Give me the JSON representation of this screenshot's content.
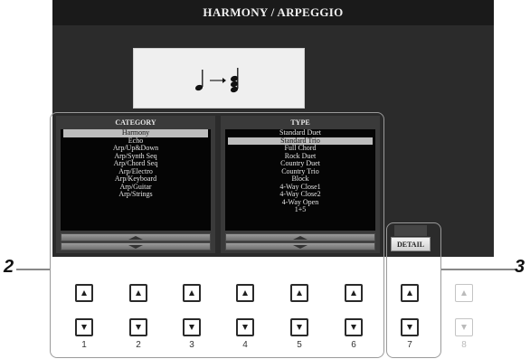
{
  "screen": {
    "title": "HARMONY / ARPEGGIO"
  },
  "category_panel": {
    "header": "CATEGORY",
    "items": [
      "Harmony",
      "Echo",
      "Arp/Up&Down",
      "Arp/Synth Seq",
      "Arp/Chord Seq",
      "Arp/Electro",
      "Arp/Keyboard",
      "Arp/Guitar",
      "Arp/Strings"
    ],
    "selected_index": 0
  },
  "type_panel": {
    "header": "TYPE",
    "items": [
      "Standard Duet",
      "Standard Trio",
      "Full Chord",
      "Rock Duet",
      "Country Duet",
      "Country Trio",
      "Block",
      "4-Way Close1",
      "4-Way Close2",
      "4-Way Open",
      "1+5"
    ],
    "selected_index": 1
  },
  "detail_button": {
    "label": "DETAIL"
  },
  "callouts": {
    "left": "2",
    "right": "3"
  },
  "panel_buttons": {
    "numbers": [
      "1",
      "2",
      "3",
      "4",
      "5",
      "6",
      "7",
      "8"
    ],
    "disabled_index": 7
  },
  "colors": {
    "screen_bg": "#2b2b2b",
    "selected_row": "#bdbdbd",
    "frame": "#9a9a9a"
  }
}
